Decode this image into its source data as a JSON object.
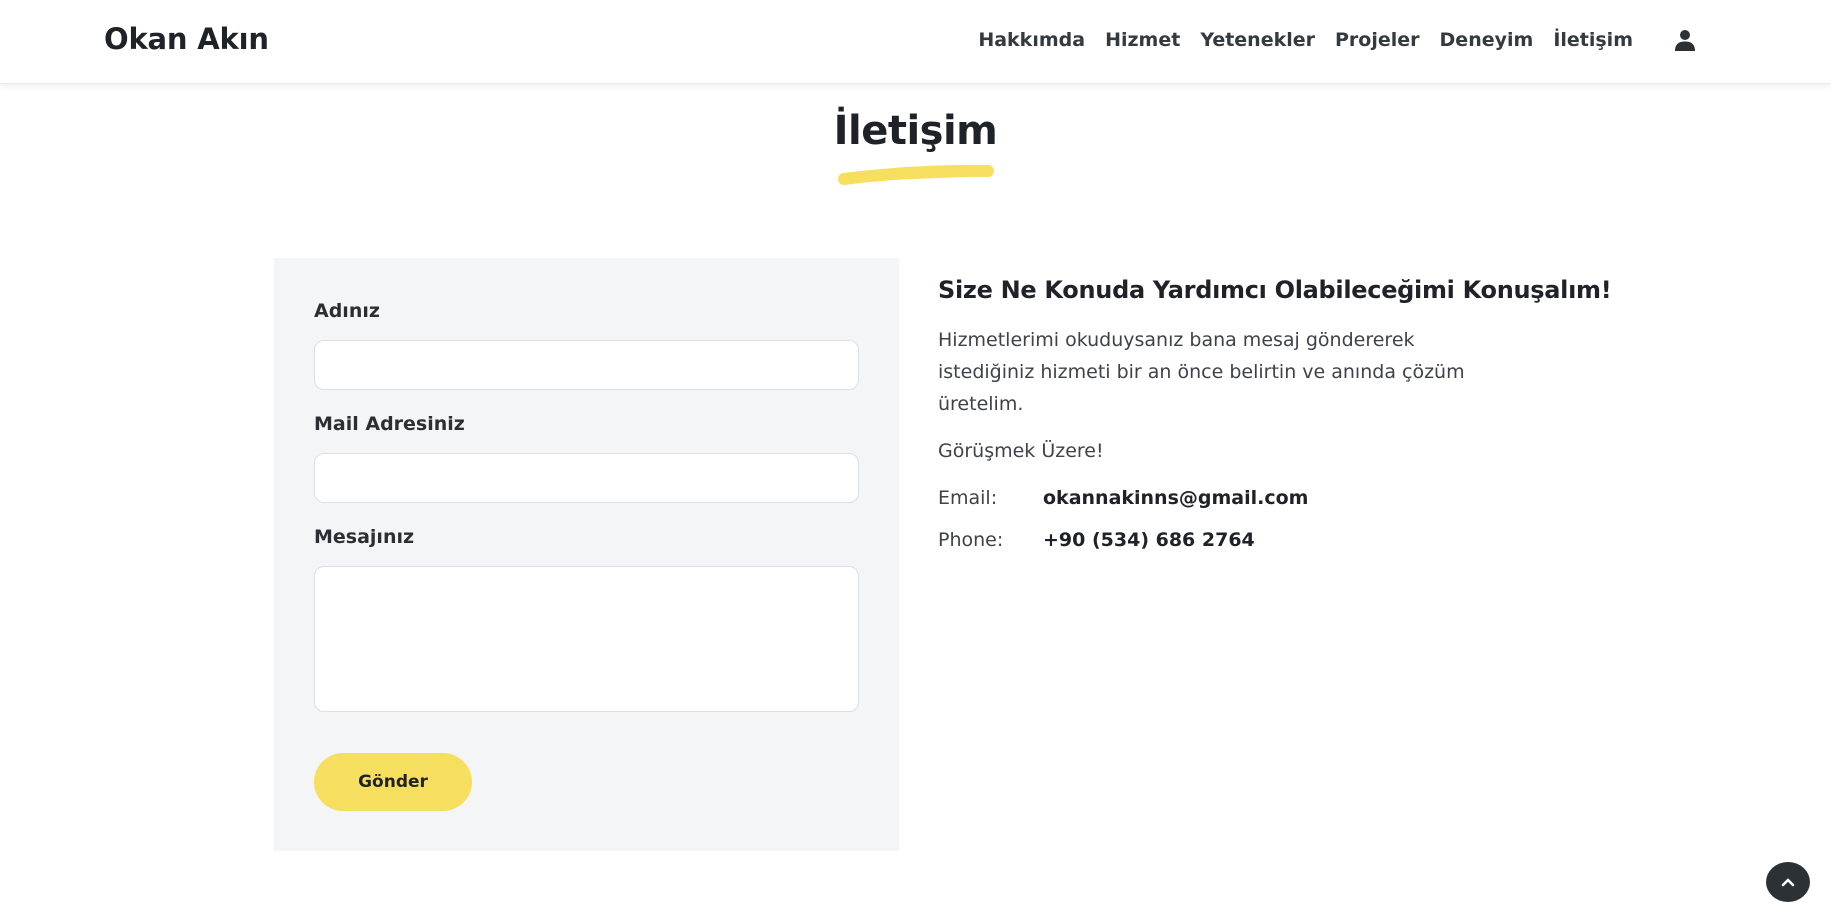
{
  "brand": "Okan Akın",
  "nav": [
    {
      "label": "Hakkımda"
    },
    {
      "label": "Hizmet"
    },
    {
      "label": "Yetenekler"
    },
    {
      "label": "Projeler"
    },
    {
      "label": "Deneyim"
    },
    {
      "label": "İletişim"
    }
  ],
  "icons": {
    "user": "user-icon",
    "back_to_top": "chevron-up-icon"
  },
  "colors": {
    "accent": "#f6df5f",
    "form_background": "#f4f5f7",
    "text_dark": "#1f2329",
    "back_to_top": "#2c3136"
  },
  "section": {
    "title": "İletişim"
  },
  "form": {
    "name_label": "Adınız",
    "name_value": "",
    "email_label": "Mail Adresiniz",
    "email_value": "",
    "message_label": "Mesajınız",
    "message_value": "",
    "submit_label": "Gönder"
  },
  "info": {
    "heading": "Size Ne Konuda Yardımcı Olabileceğimi Konuşalım!",
    "paragraph": "Hizmetlerimi okuduysanız bana mesaj göndererek istediğiniz hizmeti bir an önce belirtin ve anında çözüm üretelim.",
    "greeting": "Görüşmek Üzere!",
    "email_key": "Email:",
    "email_value": "okannakinns@gmail.com",
    "phone_key": "Phone:",
    "phone_value": "+90 (534) 686 2764"
  }
}
